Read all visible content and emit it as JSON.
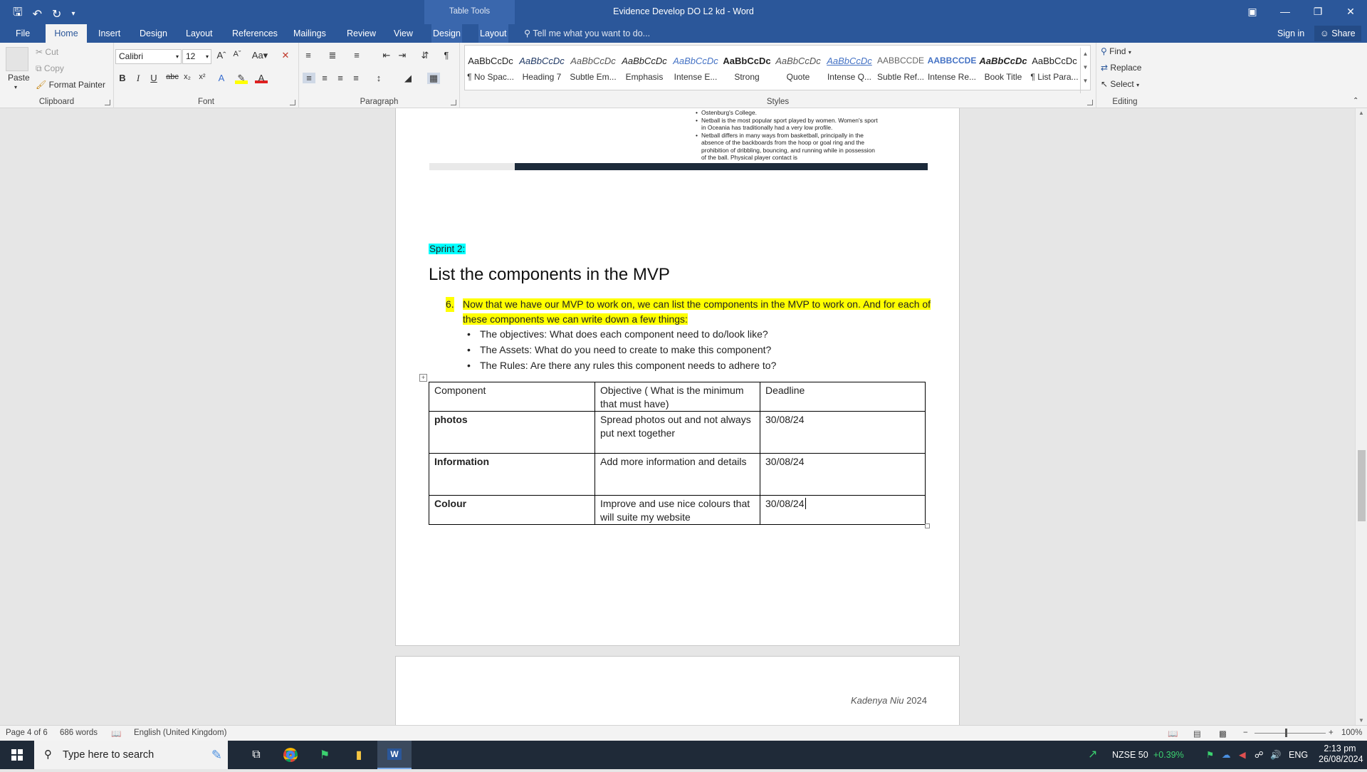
{
  "titlebar": {
    "doc_title": "Evidence Develop DO L2 kd - Word",
    "context_label": "Table Tools"
  },
  "tabs": [
    {
      "label": "File"
    },
    {
      "label": "Home"
    },
    {
      "label": "Insert"
    },
    {
      "label": "Design"
    },
    {
      "label": "Layout"
    },
    {
      "label": "References"
    },
    {
      "label": "Mailings"
    },
    {
      "label": "Review"
    },
    {
      "label": "View"
    },
    {
      "label": "Design"
    },
    {
      "label": "Layout"
    }
  ],
  "tell_me": "Tell me what you want to do...",
  "sign_in": "Sign in",
  "share": "Share",
  "ribbon": {
    "clipboard": {
      "label": "Clipboard",
      "paste": "Paste",
      "cut": "Cut",
      "copy": "Copy",
      "format_painter": "Format Painter"
    },
    "font": {
      "label": "Font",
      "name": "Calibri",
      "size": "12"
    },
    "paragraph": {
      "label": "Paragraph"
    },
    "styles": {
      "label": "Styles",
      "items": [
        {
          "sample": "AaBbCcDc",
          "name": "¶ No Spac..."
        },
        {
          "sample": "AaBbCcDc",
          "name": "Heading 7"
        },
        {
          "sample": "AaBbCcDc",
          "name": "Subtle Em..."
        },
        {
          "sample": "AaBbCcDc",
          "name": "Emphasis"
        },
        {
          "sample": "AaBbCcDc",
          "name": "Intense E..."
        },
        {
          "sample": "AaBbCcDc",
          "name": "Strong"
        },
        {
          "sample": "AaBbCcDc",
          "name": "Quote"
        },
        {
          "sample": "AaBbCcDc",
          "name": "Intense Q..."
        },
        {
          "sample": "AABBCCDE",
          "name": "Subtle Ref..."
        },
        {
          "sample": "AABBCCDE",
          "name": "Intense Re..."
        },
        {
          "sample": "AaBbCcDc",
          "name": "Book Title"
        },
        {
          "sample": "AaBbCcDc",
          "name": "¶ List Para..."
        }
      ]
    },
    "editing": {
      "label": "Editing",
      "find": "Find",
      "replace": "Replace",
      "select": "Select"
    }
  },
  "document": {
    "screenshot_bullets": [
      "Ostenburg's College.",
      "Netball is the most popular sport played by women. Women's sport in Oceania has traditionally had a very low profile.",
      "Netball differs in many ways from basketball, principally in the absence of the backboards from the hoop or goal ring and the prohibition of dribbling, bouncing, and running while in possession of the ball. Physical player contact is"
    ],
    "sprint_label": "Sprint 2:",
    "heading": "List the components in the MVP",
    "q_number": "6.",
    "q_text": "Now that we have our MVP to work on, we can list the components in the MVP to work on. And for each of these components we can write down a few things:",
    "bullets": [
      "The objectives: What does each component need to do/look like?",
      "The Assets: What do you need to create to make this component?",
      "The Rules: Are there any rules this component needs to adhere to?"
    ],
    "table": {
      "headers": [
        "Component",
        "Objective ( What is the minimum that must have)",
        "Deadline"
      ],
      "rows": [
        [
          "photos",
          " Spread photos out and not always put next together",
          "30/08/24"
        ],
        [
          "Information",
          "Add more information and details",
          "30/08/24"
        ],
        [
          "Colour",
          "Improve and use nice colours that will suite my website",
          "30/08/24"
        ]
      ]
    },
    "footer_author": "Kadenya Niu",
    "footer_year": "2024"
  },
  "status": {
    "page": "Page 4 of 6",
    "words": "686 words",
    "language": "English (United Kingdom)",
    "zoom": "100%"
  },
  "taskbar": {
    "search_placeholder": "Type here to search",
    "ticker": "NZSE 50",
    "ticker_change": "+0.39%",
    "lang": "ENG",
    "time": "2:13 pm",
    "date": "26/08/2024"
  },
  "colors": {
    "word_blue": "#2b579a",
    "highlight_yellow": "#ffff00",
    "highlight_cyan": "#00ffff",
    "ticker_green": "#3bd16f"
  }
}
